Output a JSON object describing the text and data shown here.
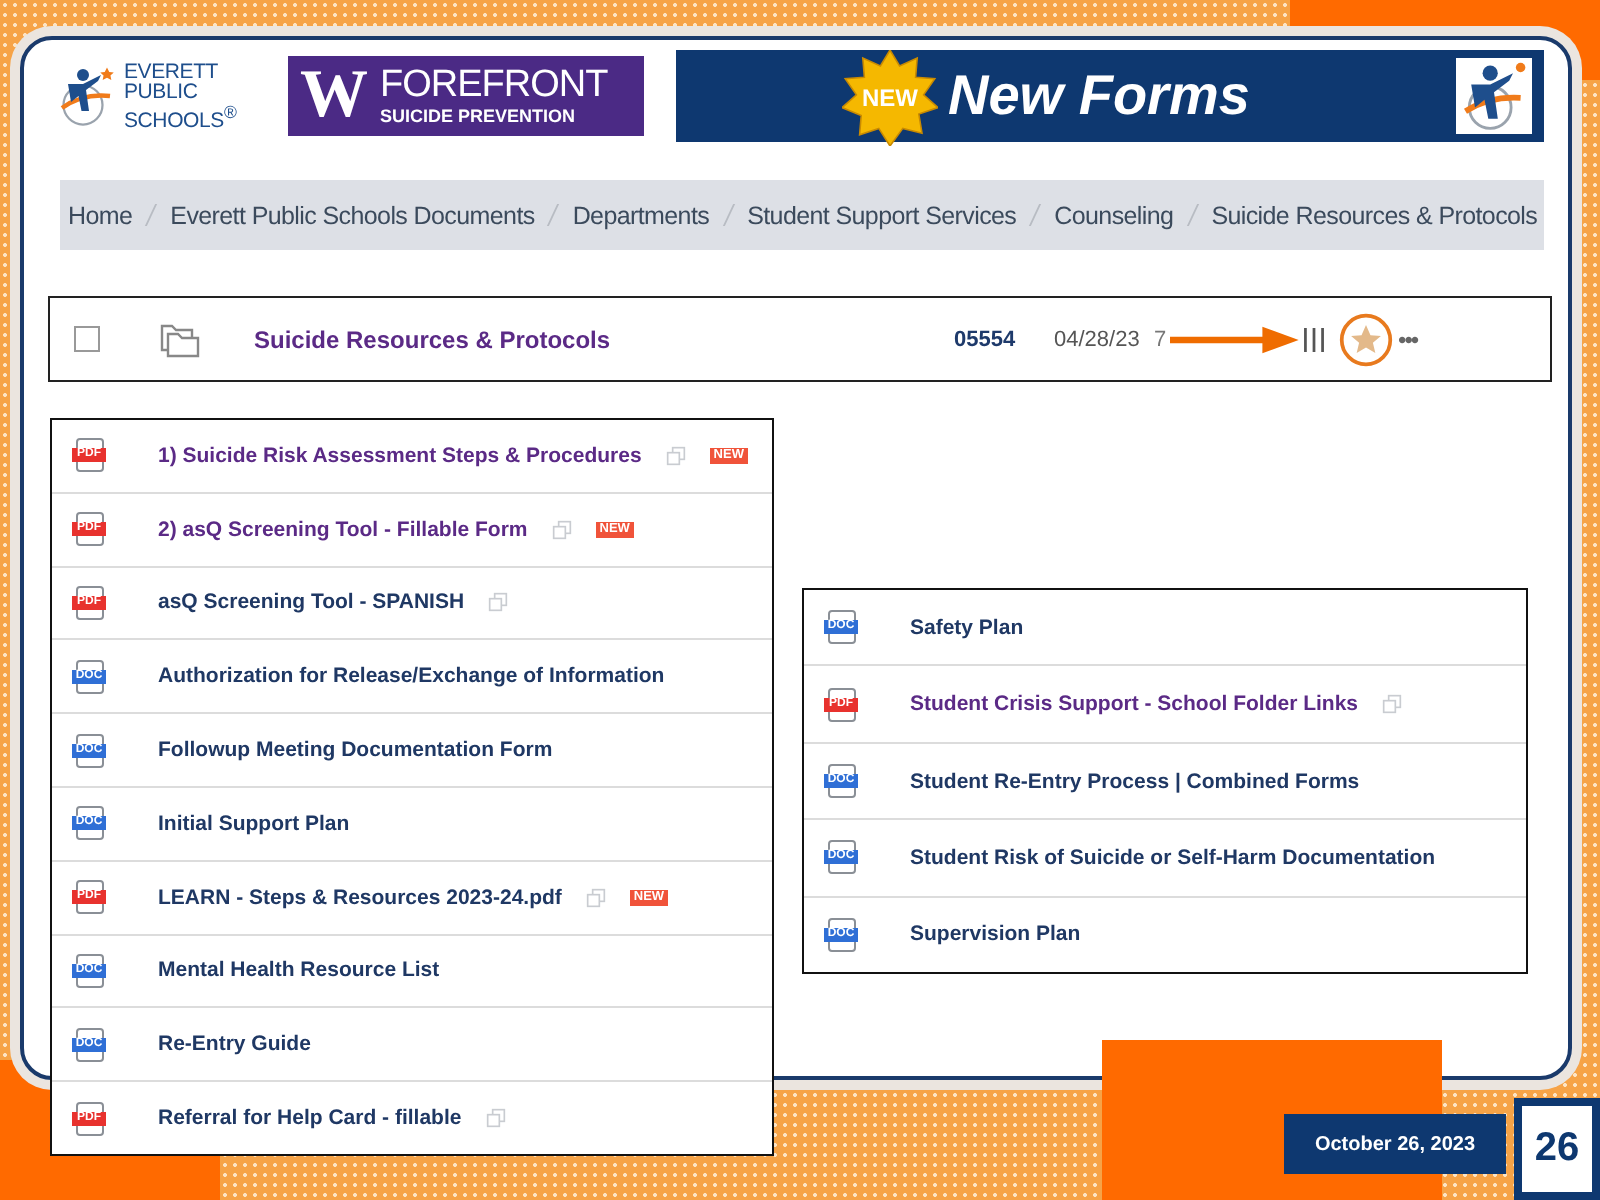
{
  "header": {
    "school_logo": {
      "lines": [
        "EVERETT",
        "PUBLIC",
        "SCHOOLS$^{®}$"
      ]
    },
    "partner_logo": {
      "mark": "W",
      "name": "FOREFRONT",
      "tagline": "SUICIDE PREVENTION"
    },
    "banner": {
      "badge": "NEW",
      "title": "New Forms"
    }
  },
  "breadcrumb": [
    "Home",
    "Everett Public Schools Documents",
    "Departments",
    "Student Support Services",
    "Counseling",
    "Suicide Resources & Protocols"
  ],
  "folder_row": {
    "checked": false,
    "name": "Suicide Resources & Protocols",
    "number": "05554",
    "date": "04/28/23",
    "count": "7",
    "more": "•••"
  },
  "left_list": [
    {
      "kind": "pdf",
      "label": "PDF",
      "name": "1) Suicide Risk Assessment Steps & Procedures",
      "visited": true,
      "link": true,
      "badge": "NEW"
    },
    {
      "kind": "pdf",
      "label": "PDF",
      "name": "2) asQ Screening Tool - Fillable Form",
      "visited": true,
      "link": true,
      "badge": "NEW"
    },
    {
      "kind": "pdf",
      "label": "PDF",
      "name": "asQ Screening Tool - SPANISH",
      "visited": false,
      "link": true
    },
    {
      "kind": "doc",
      "label": "DOC",
      "name": "Authorization for Release/Exchange of Information",
      "visited": false,
      "link": false
    },
    {
      "kind": "doc",
      "label": "DOC",
      "name": "Followup Meeting Documentation Form",
      "visited": false,
      "link": false
    },
    {
      "kind": "doc",
      "label": "DOC",
      "name": "Initial Support Plan",
      "visited": false,
      "link": false
    },
    {
      "kind": "pdf",
      "label": "PDF",
      "name": "LEARN - Steps & Resources 2023-24.pdf",
      "visited": false,
      "link": true,
      "badge": "NEW"
    },
    {
      "kind": "doc",
      "label": "DOC",
      "name": "Mental Health Resource List",
      "visited": false,
      "link": false
    },
    {
      "kind": "doc",
      "label": "DOC",
      "name": "Re-Entry Guide",
      "visited": false,
      "link": false
    },
    {
      "kind": "pdf",
      "label": "PDF",
      "name": "Referral for Help Card - fillable",
      "visited": false,
      "link": true
    }
  ],
  "right_list": [
    {
      "kind": "doc",
      "label": "DOC",
      "name": "Safety Plan",
      "visited": false,
      "link": false
    },
    {
      "kind": "pdf",
      "label": "PDF",
      "name": "Student Crisis Support - School Folder Links",
      "visited": true,
      "link": true
    },
    {
      "kind": "doc",
      "label": "DOC",
      "name": "Student Re-Entry Process | Combined Forms",
      "visited": false,
      "link": false
    },
    {
      "kind": "doc",
      "label": "DOC",
      "name": "Student Risk of Suicide or Self-Harm Documentation",
      "visited": false,
      "link": false
    },
    {
      "kind": "doc",
      "label": "DOC",
      "name": "Supervision Plan",
      "visited": false,
      "link": false
    }
  ],
  "footer": {
    "date": "October 26, 2023",
    "page": "26"
  }
}
